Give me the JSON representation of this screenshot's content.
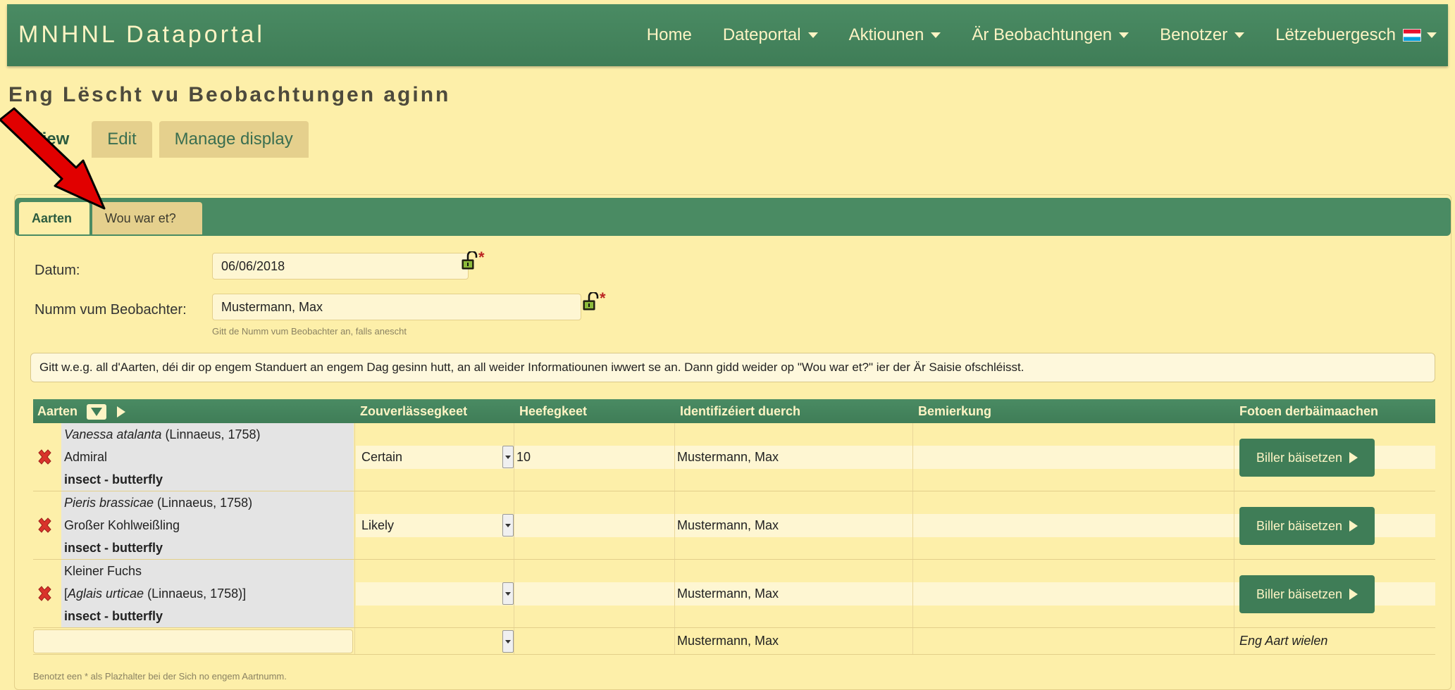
{
  "navbar": {
    "brand": "MNHNL Dataportal",
    "items": [
      {
        "label": "Home",
        "caret": false
      },
      {
        "label": "Dateportal",
        "caret": true
      },
      {
        "label": "Aktiounen",
        "caret": true
      },
      {
        "label": "Är Beobachtungen",
        "caret": true
      },
      {
        "label": "Benotzer",
        "caret": true
      },
      {
        "label": "Lëtzebuergesch",
        "caret": true,
        "flag": "luxembourg-flag"
      }
    ]
  },
  "page": {
    "title": "Eng Lëscht vu Beobachtungen aginn",
    "tabs": [
      "View",
      "Edit",
      "Manage display"
    ]
  },
  "form": {
    "subtabs": [
      "Aarten",
      "Wou war et?"
    ],
    "date_label": "Datum:",
    "date_value": "06/06/2018",
    "observer_label": "Numm vum Beobachter:",
    "observer_value": "Mustermann, Max",
    "observer_help": "Gitt de Numm vum Beobachter an, falls anescht",
    "required_mark": "*",
    "info": "Gitt w.e.g. all d'Aarten, déi dir op engem Standuert an engem Dag gesinn hutt, an all weider Informatiounen iwwert se an. Dann gidd weider op \"Wou war et?\" ier der Är Saisie ofschléisst."
  },
  "table": {
    "headers": [
      "Aarten",
      "Zouverlässegkeet",
      "Heefegkeet",
      "Identifizéiert duerch",
      "Bemierkung",
      "Fotoen derbäimaachen"
    ],
    "rows": [
      {
        "sci": "Vanessa atalanta",
        "author": " (Linnaeus, 1758)",
        "common": "Admiral",
        "group": "insect - butterfly",
        "certainty": "Certain",
        "abundance": "10",
        "identified_by": "Mustermann, Max",
        "button": "Biller bäisetzen"
      },
      {
        "sci": "Pieris brassicae",
        "author": " (Linnaeus, 1758)",
        "common": "Großer Kohlweißling",
        "group": "insect - butterfly",
        "certainty": "Likely",
        "abundance": "",
        "identified_by": "Mustermann, Max",
        "button": "Biller bäisetzen"
      },
      {
        "common_first": "Kleiner Fuchs",
        "bracket_open": "[",
        "sci": "Aglais urticae",
        "author": " (Linnaeus, 1758)]",
        "group": "insect - butterfly",
        "certainty": "",
        "abundance": "",
        "identified_by": "Mustermann, Max",
        "button": "Biller bäisetzen"
      }
    ],
    "new_row": {
      "identified_by": "Mustermann, Max",
      "add_label": "Eng Aart wielen"
    },
    "footnote": "Benotzt een * als Plazhalter bei der Sich no engem Aartnumm."
  },
  "colors": {
    "nav_green": "#4a8b63",
    "page_bg": "#fdefa9",
    "annotation_red": "#e10000"
  }
}
